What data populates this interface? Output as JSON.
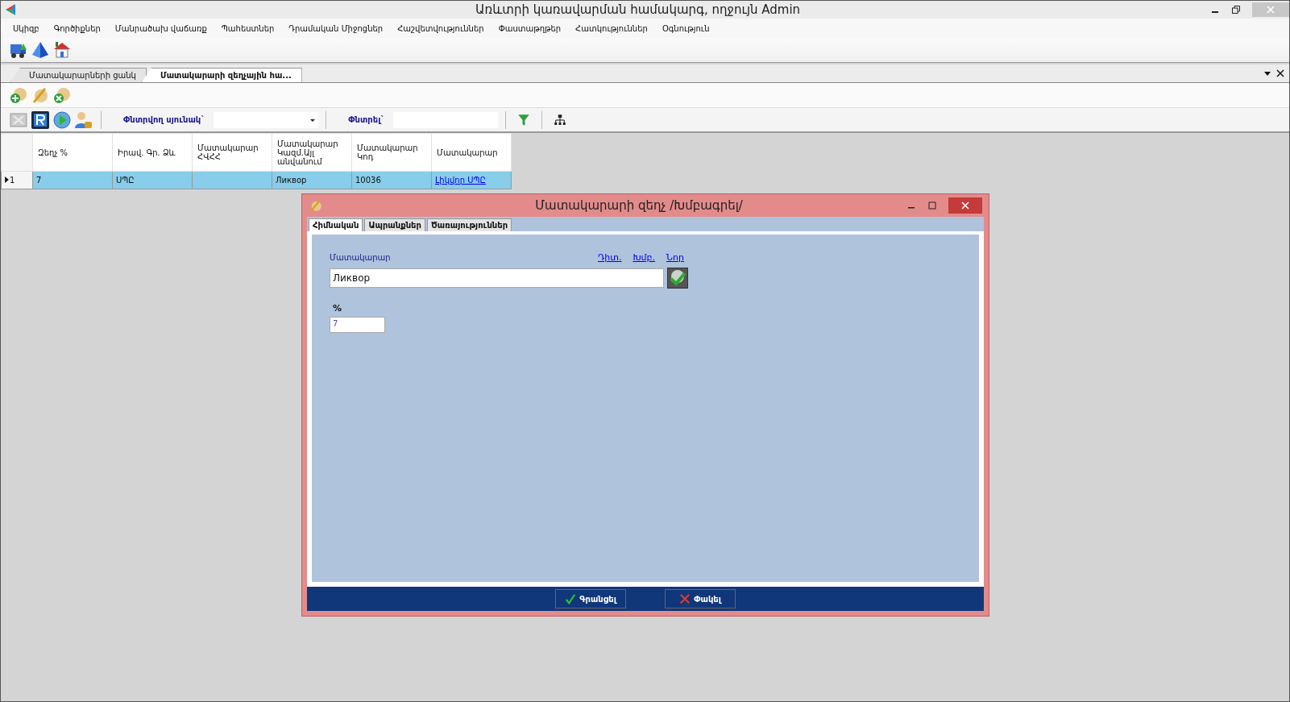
{
  "window": {
    "title": "Առևտրի կառավարման համակարգ, ողջույն Admin"
  },
  "menu": [
    "Սկիզբ",
    "Գործիքներ",
    "Մանրածախ վաճառք",
    "Պահեստներ",
    "Դրամական Միջոցներ",
    "Հաշվետվություններ",
    "Փաստաթղթեր",
    "Հատկություններ",
    "Օգնություն"
  ],
  "doc_tabs": [
    {
      "label": "Մատակարարների ցանկ",
      "selected": false
    },
    {
      "label": "Մատակարարի զեղչային հա...",
      "selected": true
    }
  ],
  "search": {
    "column_label": "Փնտրվող սյունակ`",
    "find_label": "Փնտրել`"
  },
  "table": {
    "columns": [
      "Զեղչ %",
      "Իրավ. Գր. Ձև",
      "Մատակարար ՀՎՀՀ",
      "Մատակարար Կազմ.Այլ անվանում",
      "Մատակարար Կոդ",
      "Մատակարար"
    ],
    "rows": [
      {
        "number": "1",
        "selected": true,
        "cells": [
          {
            "kind": "text",
            "text": "7"
          },
          {
            "kind": "text",
            "text": "ՍՊԸ"
          },
          {
            "kind": "empty"
          },
          {
            "kind": "text",
            "text": "Ликвор"
          },
          {
            "kind": "text",
            "text": "10036"
          },
          {
            "kind": "link",
            "text": "Լիկվոր ՍՊԸ"
          }
        ]
      }
    ]
  },
  "dialog": {
    "title": "Մատակարարի զեղչ /Խմբագրել/",
    "tabs": [
      {
        "label": "Հիմնական",
        "selected": true
      },
      {
        "label": "Ապրանքներ",
        "selected": false
      },
      {
        "label": "Ծառայություններ",
        "selected": false
      }
    ],
    "supplier_label": "Մատակարար",
    "links": [
      "Դիտ.",
      "Խմբ.",
      "Նոր"
    ],
    "supplier_value": "Ликвор",
    "percent_label": "%",
    "percent_value": "7",
    "buttons": [
      {
        "kind": "ok",
        "label": "Գրանցել"
      },
      {
        "kind": "cancel",
        "label": "Փակել"
      }
    ]
  }
}
